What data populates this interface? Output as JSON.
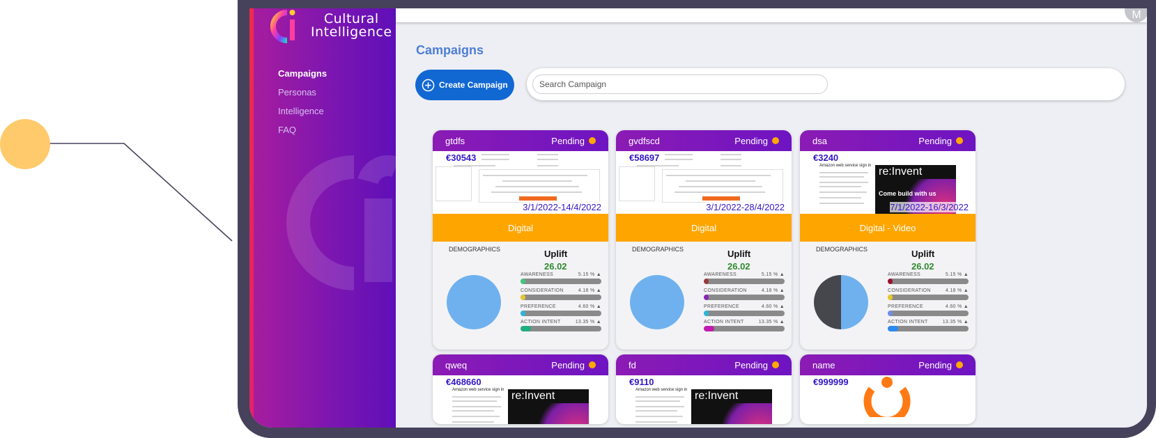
{
  "brand": {
    "line1": "Cultural",
    "line2": "Intelligence"
  },
  "nav": [
    "Campaigns",
    "Personas",
    "Intelligence",
    "FAQ"
  ],
  "avatar_initial": "M",
  "page_title": "Campaigns",
  "create_button": "Create Campaign",
  "search_placeholder": "Search Campaign",
  "labels": {
    "demographics": "DEMOGRAPHICS",
    "uplift": "Uplift",
    "status": "Pending"
  },
  "metric_names": [
    "AWARENESS",
    "CONSIDERATION",
    "PREFERENCE",
    "ACTION INTENT"
  ],
  "cards": [
    {
      "name": "gtdfs",
      "status": "Pending",
      "budget": "€30543",
      "dates": "3/1/2022-14/4/2022",
      "channel": "Digital",
      "uplift": "26.02",
      "metrics": [
        {
          "value": "5.15 % ▲",
          "fill": 0.05,
          "color": "#3fc77b"
        },
        {
          "value": "4.18 % ▲",
          "fill": 0.04,
          "color": "#e5c92a"
        },
        {
          "value": "4.60 % ▲",
          "fill": 0.05,
          "color": "#2ab7d8"
        },
        {
          "value": "13.35 % ▲",
          "fill": 0.13,
          "color": "#1eaf80"
        }
      ],
      "pie": [
        {
          "share": 1.0,
          "color": "#6fb1ee"
        }
      ],
      "thumb": "form"
    },
    {
      "name": "gvdfscd",
      "status": "Pending",
      "budget": "€58697",
      "dates": "3/1/2022-28/4/2022",
      "channel": "Digital",
      "uplift": "26.02",
      "metrics": [
        {
          "value": "5.15 % ▲",
          "fill": 0.05,
          "color": "#9b3a3a"
        },
        {
          "value": "4.18 % ▲",
          "fill": 0.04,
          "color": "#8a26b8"
        },
        {
          "value": "4.60 % ▲",
          "fill": 0.05,
          "color": "#2ab7d8"
        },
        {
          "value": "13.35 % ▲",
          "fill": 0.13,
          "color": "#c21bb0"
        }
      ],
      "pie": [
        {
          "share": 1.0,
          "color": "#6fb1ee"
        }
      ],
      "thumb": "form"
    },
    {
      "name": "dsa",
      "status": "Pending",
      "budget": "€3240",
      "dates": "7/1/2022-16/3/2022",
      "channel": "Digital - Video",
      "uplift": "26.02",
      "metrics": [
        {
          "value": "5.15 % ▲",
          "fill": 0.05,
          "color": "#9b1030"
        },
        {
          "value": "4.18 % ▲",
          "fill": 0.04,
          "color": "#e5c92a"
        },
        {
          "value": "4.60 % ▲",
          "fill": 0.05,
          "color": "#6e8fe6"
        },
        {
          "value": "13.35 % ▲",
          "fill": 0.13,
          "color": "#2a8af0"
        }
      ],
      "pie": [
        {
          "share": 0.5,
          "color": "#6fb1ee"
        },
        {
          "share": 0.5,
          "color": "#46464d"
        }
      ],
      "thumb": "reinvent",
      "thumb_heading": "Amazon web service sign in",
      "thumb_banner": "Come build with us"
    },
    {
      "name": "qweq",
      "status": "Pending",
      "budget": "€468660",
      "thumb": "reinvent",
      "thumb_heading": "Amazon web service sign in"
    },
    {
      "name": "fd",
      "status": "Pending",
      "budget": "€9110",
      "thumb": "reinvent",
      "thumb_heading": "Amazon web service sign in"
    },
    {
      "name": "name",
      "status": "Pending",
      "budget": "€999999",
      "thumb": "logo"
    }
  ],
  "colors": {
    "accent": "#1268d2",
    "channel": "#ffa500",
    "header_start": "#8b1bb4",
    "header_end": "#6e14c2",
    "budget": "#3417c5",
    "uplift": "#2e8b2e",
    "pending_dot": "#ffa800"
  }
}
